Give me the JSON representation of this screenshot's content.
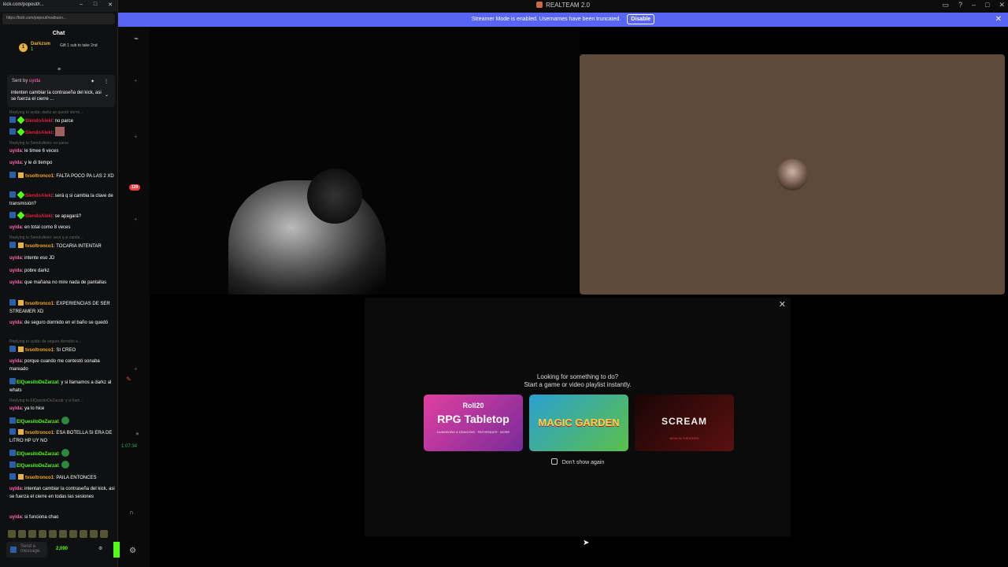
{
  "discord": {
    "title": "REALTEAM 2.0",
    "streamer_notice": "Streamer Mode is enabled. Usernames have been truncated.",
    "disable_label": "Disable",
    "notification_badge": "129",
    "call_time": "1:07:34",
    "activity": {
      "line1": "Looking for something to do?",
      "line2": "Start a game or video playlist instantly.",
      "cards": [
        {
          "logo": "Roll20",
          "title": "RPG Tabletop",
          "sub": "DUNGEONS & DRAGONS · PATHFINDER · MORE"
        },
        {
          "logo": "",
          "title": "MAGIC GARDEN",
          "sub": ""
        },
        {
          "logo": "",
          "title": "SCREAM",
          "sub": "NOW IN THEATERS"
        }
      ],
      "dont_show": "Don't show again"
    }
  },
  "kick": {
    "window_title": "kick.com/popout/r...",
    "url": "https://kick.com/popout/realbuen...",
    "header": "Chat",
    "sub_gift": {
      "rank": "1",
      "name": "Darkzsm",
      "count": "1",
      "text": "Gift 1 sub to take 2nd"
    },
    "pinned": {
      "sent_by_prefix": "Sent by",
      "sent_by_user": "uyida",
      "message": "intenten cambiar la contraseña del kick, asi se fuerza el cierre ..."
    },
    "messages": [
      {
        "reply": "Replying to uyida: darkz se quedó dormi...",
        "user": "SiendoAleki",
        "user_color": "red",
        "text": ": no parce"
      },
      {
        "user": "SiendoAleki",
        "user_color": "red",
        "text": ":"
      },
      {
        "reply": "Replying to SiendoAleki: no parce",
        "user": "uyida",
        "user_color": "pink",
        "text": ": le timee 6 veces"
      },
      {
        "user": "uyida",
        "user_color": "pink",
        "text": ": y le di tiempo"
      },
      {
        "user": "tvsoltronco1",
        "user_color": "orange",
        "text": ": FALTA POCO PA LAS 2 XD"
      },
      {
        "user": "SiendoAleki",
        "user_color": "red",
        "text": ": será q si cambia la clave de transmisión?"
      },
      {
        "user": "SiendoAleki",
        "user_color": "red",
        "text": ": se apagará?"
      },
      {
        "user": "uyida",
        "user_color": "pink",
        "text": ": en total como 8 veces"
      },
      {
        "reply": "Replying to SiendoAleki: será q si cambi...",
        "user": "tvsoltronco1",
        "user_color": "orange",
        "text": ": TOCARIA INTENTAR"
      },
      {
        "user": "uyida",
        "user_color": "pink",
        "text": ": intente eso JD"
      },
      {
        "user": "uyida",
        "user_color": "pink",
        "text": ": pobre darkz"
      },
      {
        "user": "uyida",
        "user_color": "pink",
        "text": ": que mañana no mire nada de pantallas"
      },
      {
        "user": "tvsoltronco1",
        "user_color": "orange",
        "text": ": EXPERIENCIAS DE SER STREAMER XD"
      },
      {
        "user": "uyida",
        "user_color": "pink",
        "text": ": de seguro dormido en el baño se quedó"
      },
      {
        "reply": "Replying to uyida: de seguro dormido e...",
        "user": "tvsoltronco1",
        "user_color": "orange",
        "text": ": SI CREO"
      },
      {
        "user": "uyida",
        "user_color": "pink",
        "text": ": porque cuando me contestó sonaba mareado"
      },
      {
        "user": "ElQuesitoDeZarzal",
        "user_color": "green",
        "text": ": y si llamamos a darkz al whats"
      },
      {
        "reply": "Replying to ElQuesitoDeZarzal: y si llam...",
        "user": "uyida",
        "user_color": "pink",
        "text": ": ya lo hice"
      },
      {
        "user": "ElQuesitoDeZarzal",
        "user_color": "green",
        "text": ":"
      },
      {
        "user": "tvsoltronco1",
        "user_color": "orange",
        "text": ": ESA BOTELLA SI ERA DE LITRO HP UY NO"
      },
      {
        "user": "ElQuesitoDeZarzal",
        "user_color": "green",
        "text": ":"
      },
      {
        "user": "ElQuesitoDeZarzal",
        "user_color": "green",
        "text": ":"
      },
      {
        "user": "tvsoltronco1",
        "user_color": "orange",
        "text": ": PAILA ENTONCES"
      },
      {
        "user": "uyida",
        "user_color": "pink",
        "text": ": intentan cambiar la contraseña del kick, asi se fuerza el cierre en todas las sesiones"
      },
      {
        "user": "uyida",
        "user_color": "pink",
        "text": ": si funciona chao"
      }
    ],
    "input_placeholder": "Send a message",
    "points": "2,090"
  }
}
